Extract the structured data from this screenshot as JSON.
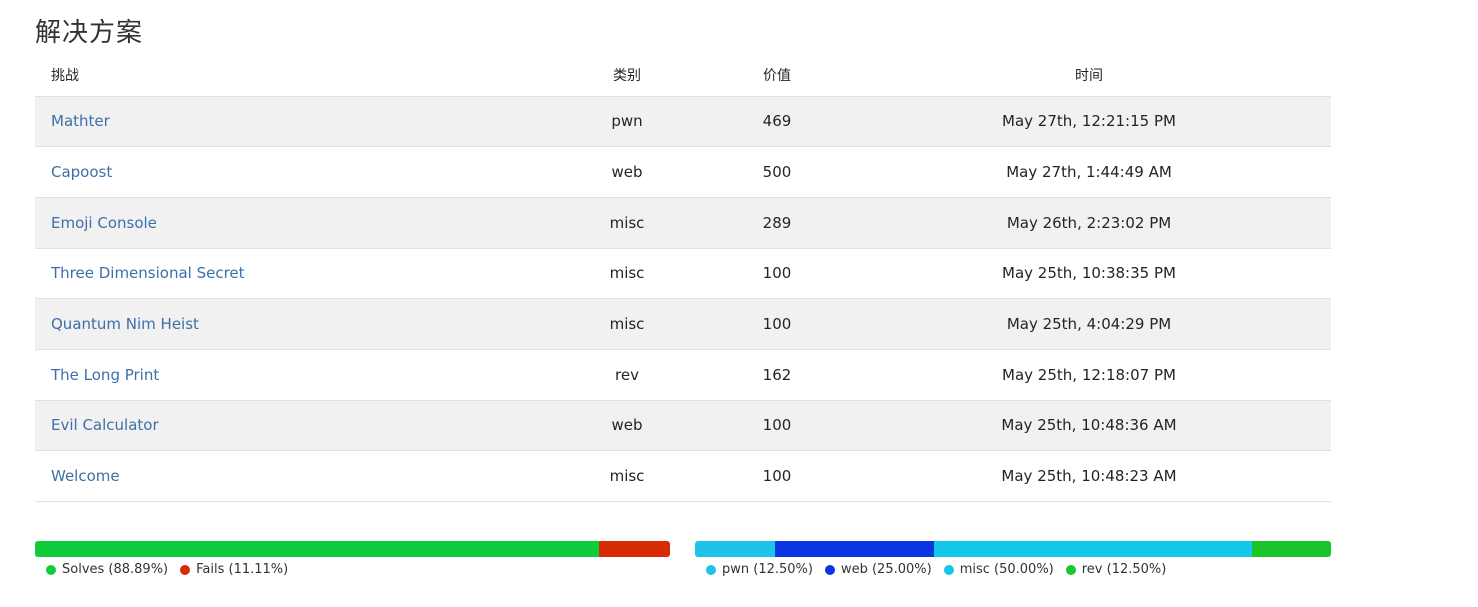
{
  "section": {
    "title": "解决方案"
  },
  "table": {
    "headers": {
      "challenge": "挑战",
      "category": "类别",
      "value": "价值",
      "time": "时间"
    },
    "rows": [
      {
        "name": "Mathter",
        "category": "pwn",
        "value": "469",
        "time": "May 27th, 12:21:15 PM"
      },
      {
        "name": "Capoost",
        "category": "web",
        "value": "500",
        "time": "May 27th, 1:44:49 AM"
      },
      {
        "name": "Emoji Console",
        "category": "misc",
        "value": "289",
        "time": "May 26th, 2:23:02 PM"
      },
      {
        "name": "Three Dimensional Secret",
        "category": "misc",
        "value": "100",
        "time": "May 25th, 10:38:35 PM"
      },
      {
        "name": "Quantum Nim Heist",
        "category": "misc",
        "value": "100",
        "time": "May 25th, 4:04:29 PM"
      },
      {
        "name": "The Long Print",
        "category": "rev",
        "value": "162",
        "time": "May 25th, 12:18:07 PM"
      },
      {
        "name": "Evil Calculator",
        "category": "web",
        "value": "100",
        "time": "May 25th, 10:48:36 AM"
      },
      {
        "name": "Welcome",
        "category": "misc",
        "value": "100",
        "time": "May 25th, 10:48:23 AM"
      }
    ]
  },
  "solve_bar": {
    "segments": [
      {
        "label": "Solves (88.89%)",
        "fraction": 0.8889,
        "color": "#0ecc3c"
      },
      {
        "label": "Fails (11.11%)",
        "fraction": 0.1111,
        "color": "#d62b03"
      }
    ]
  },
  "category_bar": {
    "segments": [
      {
        "label": "pwn (12.50%)",
        "fraction": 0.125,
        "color": "#1ec3e8"
      },
      {
        "label": "web (25.00%)",
        "fraction": 0.25,
        "color": "#0b35e0"
      },
      {
        "label": "misc (50.00%)",
        "fraction": 0.5,
        "color": "#12c8ea"
      },
      {
        "label": "rev (12.50%)",
        "fraction": 0.125,
        "color": "#1cc42c"
      }
    ]
  }
}
